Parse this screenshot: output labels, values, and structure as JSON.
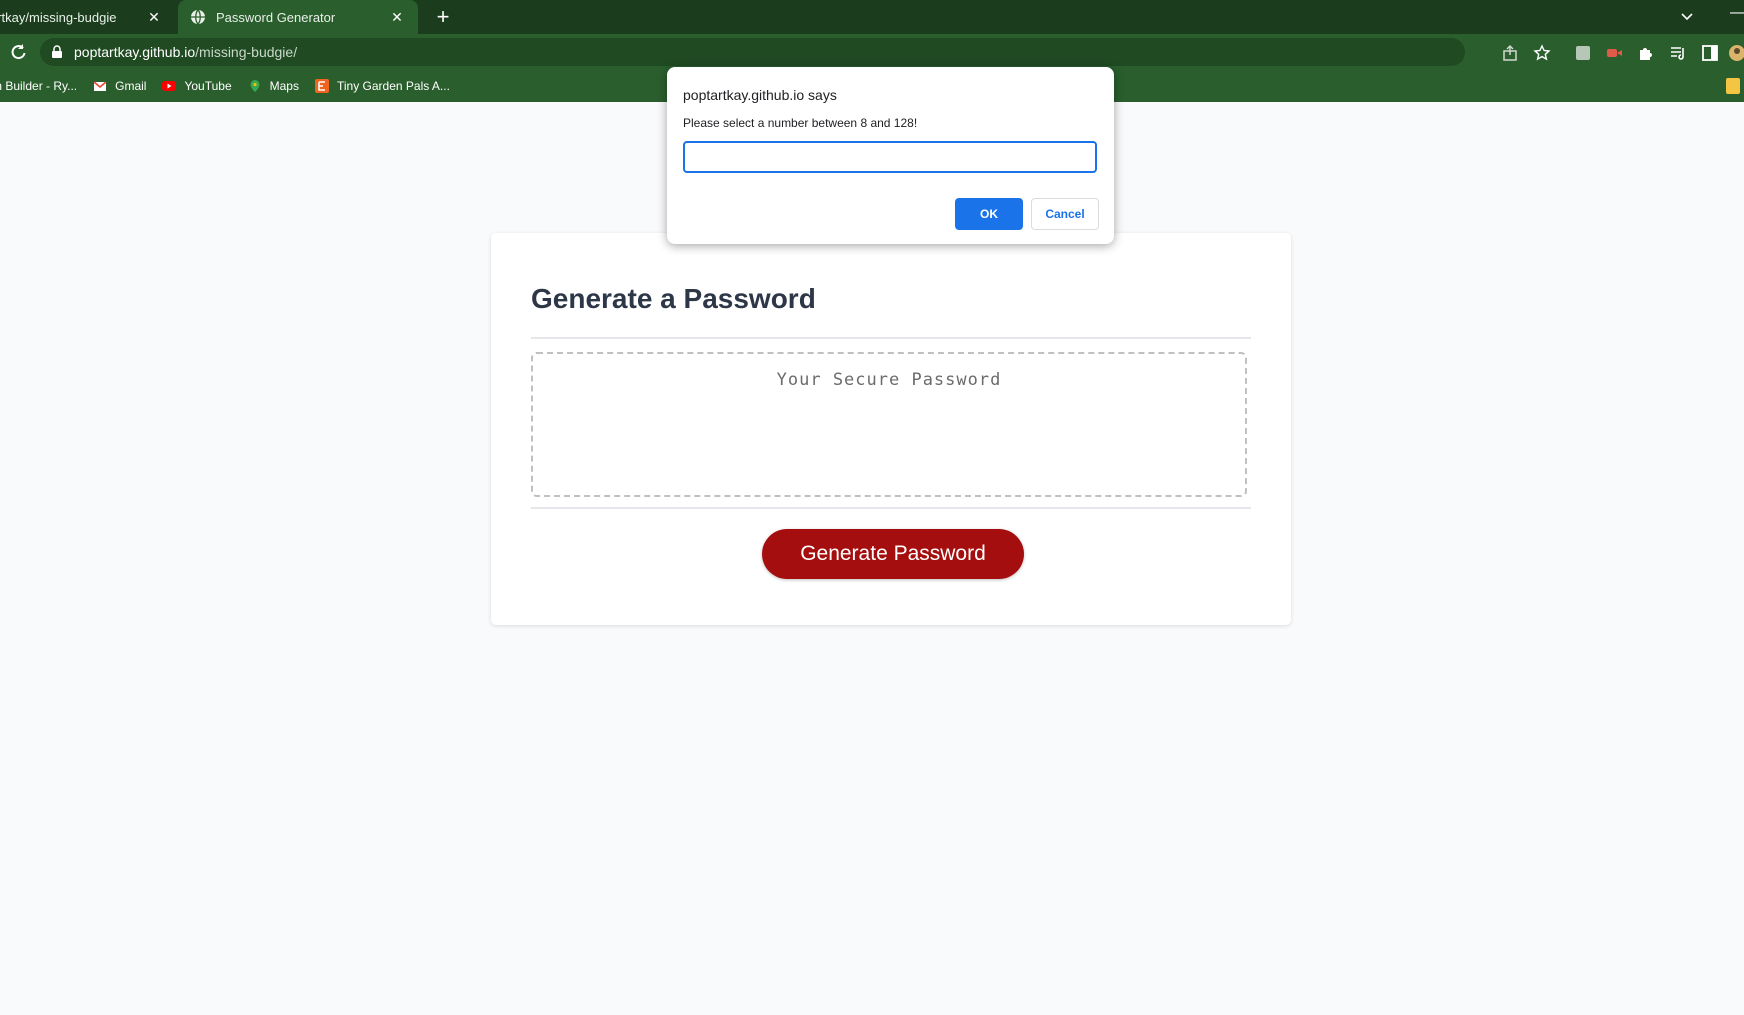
{
  "browser": {
    "tabs": [
      {
        "title": "artkay/missing-budgie",
        "active": false
      },
      {
        "title": "Password Generator",
        "active": true
      }
    ],
    "new_tab_label": "+",
    "url_host": "poptartkay.github.io",
    "url_path": "/missing-budgie/",
    "bookmarks": [
      {
        "label": "m Builder - Ry...",
        "icon": "bookmark-icon"
      },
      {
        "label": "Gmail",
        "icon": "gmail-icon"
      },
      {
        "label": "YouTube",
        "icon": "youtube-icon"
      },
      {
        "label": "Maps",
        "icon": "maps-icon"
      },
      {
        "label": "Tiny Garden Pals A...",
        "icon": "etsy-icon"
      }
    ],
    "colors": {
      "tabstrip": "#1b3d1e",
      "toolbar": "#2a5e2d"
    }
  },
  "page": {
    "title": "Generate a Password",
    "password_placeholder": "Your Secure Password",
    "generate_label": "Generate Password",
    "colors": {
      "button": "#a50e0e",
      "background": "#f9fafb"
    }
  },
  "dialog": {
    "origin": "poptartkay.github.io says",
    "message": "Please select a number between 8 and 128!",
    "input_value": "",
    "ok_label": "OK",
    "cancel_label": "Cancel",
    "colors": {
      "accent": "#1a73e8"
    }
  }
}
